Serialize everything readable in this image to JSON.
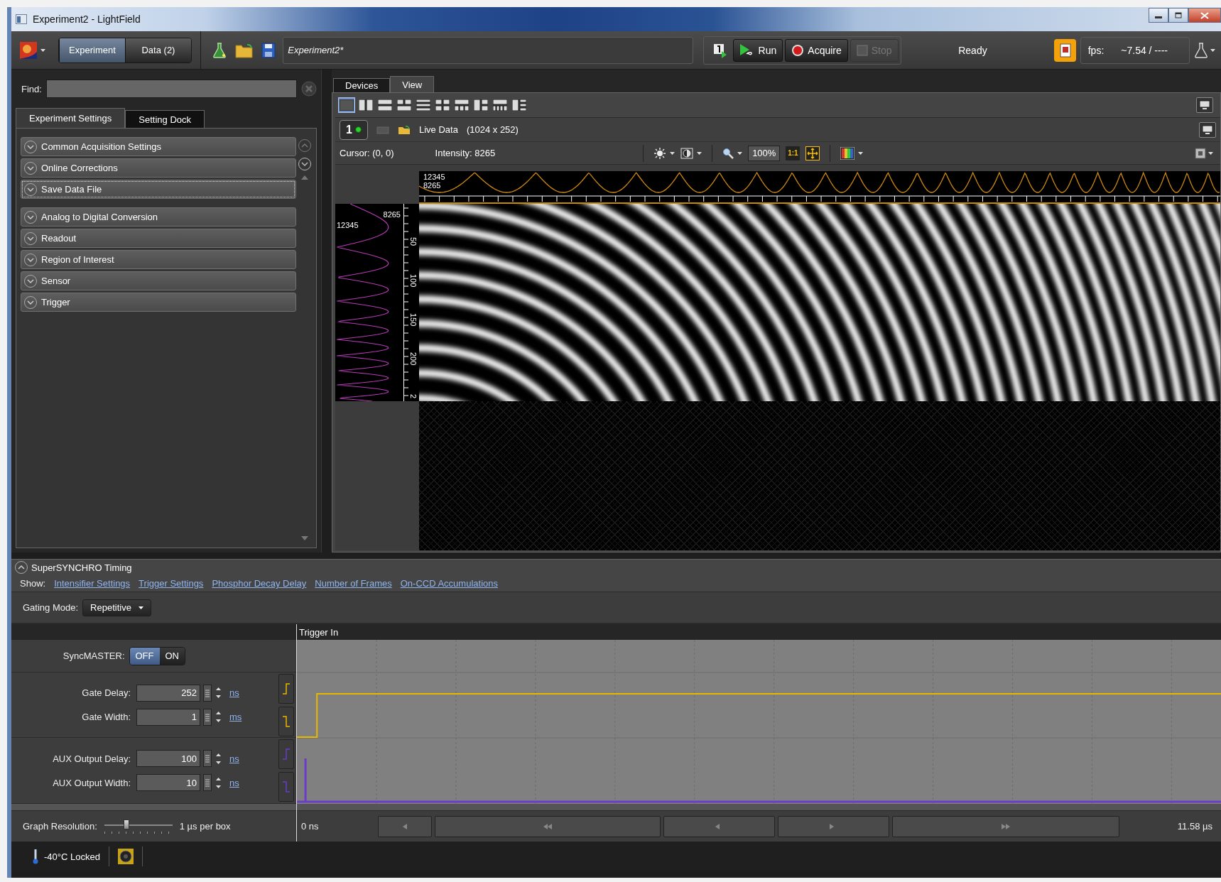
{
  "window": {
    "title": "Experiment2 - LightField"
  },
  "toolbar": {
    "modes": [
      {
        "label": "Experiment",
        "selected": true
      },
      {
        "label": "Data (2)",
        "selected": false
      }
    ],
    "experiment_name": "Experiment2*",
    "actions": [
      {
        "label": "Run",
        "kind": "run",
        "disabled": false
      },
      {
        "label": "Acquire",
        "kind": "acquire",
        "disabled": false
      },
      {
        "label": "Stop",
        "kind": "stop",
        "disabled": true
      }
    ],
    "status": "Ready",
    "fps_label": "fps:",
    "fps_value": "~7.54 / ----"
  },
  "settings": {
    "find_label": "Find:",
    "tabs": [
      {
        "label": "Experiment Settings",
        "selected": true
      },
      {
        "label": "Setting Dock",
        "selected": false
      }
    ],
    "groups": [
      {
        "items": [
          {
            "label": "Common Acquisition Settings",
            "focused": false
          },
          {
            "label": "Online Corrections",
            "focused": false
          },
          {
            "label": "Save Data File",
            "focused": true
          }
        ]
      },
      {
        "items": [
          {
            "label": "Analog to Digital Conversion",
            "focused": false
          },
          {
            "label": "Readout",
            "focused": false
          },
          {
            "label": "Region of Interest",
            "focused": false
          },
          {
            "label": "Sensor",
            "focused": false
          },
          {
            "label": "Trigger",
            "focused": false
          }
        ]
      }
    ]
  },
  "view": {
    "tabs": [
      {
        "label": "Devices",
        "selected": false
      },
      {
        "label": "View",
        "selected": true
      }
    ],
    "layouts": [
      {
        "selected": true
      },
      {
        "selected": false
      },
      {
        "selected": false
      },
      {
        "selected": false
      },
      {
        "selected": false
      },
      {
        "selected": false
      },
      {
        "selected": false
      },
      {
        "selected": false
      },
      {
        "selected": false
      },
      {
        "selected": false
      }
    ],
    "display": {
      "number": "1",
      "source": "Live Data",
      "size": "(1024 x 252)",
      "cursor": "Cursor: (0, 0)",
      "intensity": "Intensity: 8265",
      "zoom": "100%",
      "scale": "1:1"
    },
    "horizontal_profile": {
      "top_label": "12345",
      "bottom_label": "8265"
    },
    "vertical_profile": {
      "top_label": "8265",
      "left_label": "12345",
      "ticks": [
        "50",
        "100",
        "150",
        "200",
        "2"
      ]
    }
  },
  "timing": {
    "title": "SuperSYNCHRO Timing",
    "show_label": "Show:",
    "links": [
      "Intensifier Settings",
      "Trigger Settings",
      "Phosphor Decay Delay",
      "Number of Frames",
      "On-CCD Accumulations"
    ],
    "gating_label": "Gating Mode:",
    "gating_mode": "Repetitive",
    "graph_title": "Trigger In",
    "syncmaster": {
      "label": "SyncMASTER:",
      "options": [
        {
          "label": "OFF",
          "selected": true
        },
        {
          "label": "ON",
          "selected": false
        }
      ]
    },
    "groups": [
      {
        "kind": "gate",
        "params": [
          {
            "label": "Gate Delay:",
            "value": "252",
            "unit": "ns"
          },
          {
            "label": "Gate Width:",
            "value": "1",
            "unit": "ms"
          }
        ]
      },
      {
        "kind": "aux",
        "params": [
          {
            "label": "AUX Output Delay:",
            "value": "100",
            "unit": "ns"
          },
          {
            "label": "AUX Output Width:",
            "value": "10",
            "unit": "ns"
          }
        ]
      }
    ],
    "resolution": {
      "label": "Graph Resolution:",
      "level": 0.32,
      "reading": "1 µs per box"
    },
    "axis_start": "0 ns",
    "axis_end": "11.58 µs"
  },
  "status_bar": {
    "temperature": "-40°C Locked"
  }
}
